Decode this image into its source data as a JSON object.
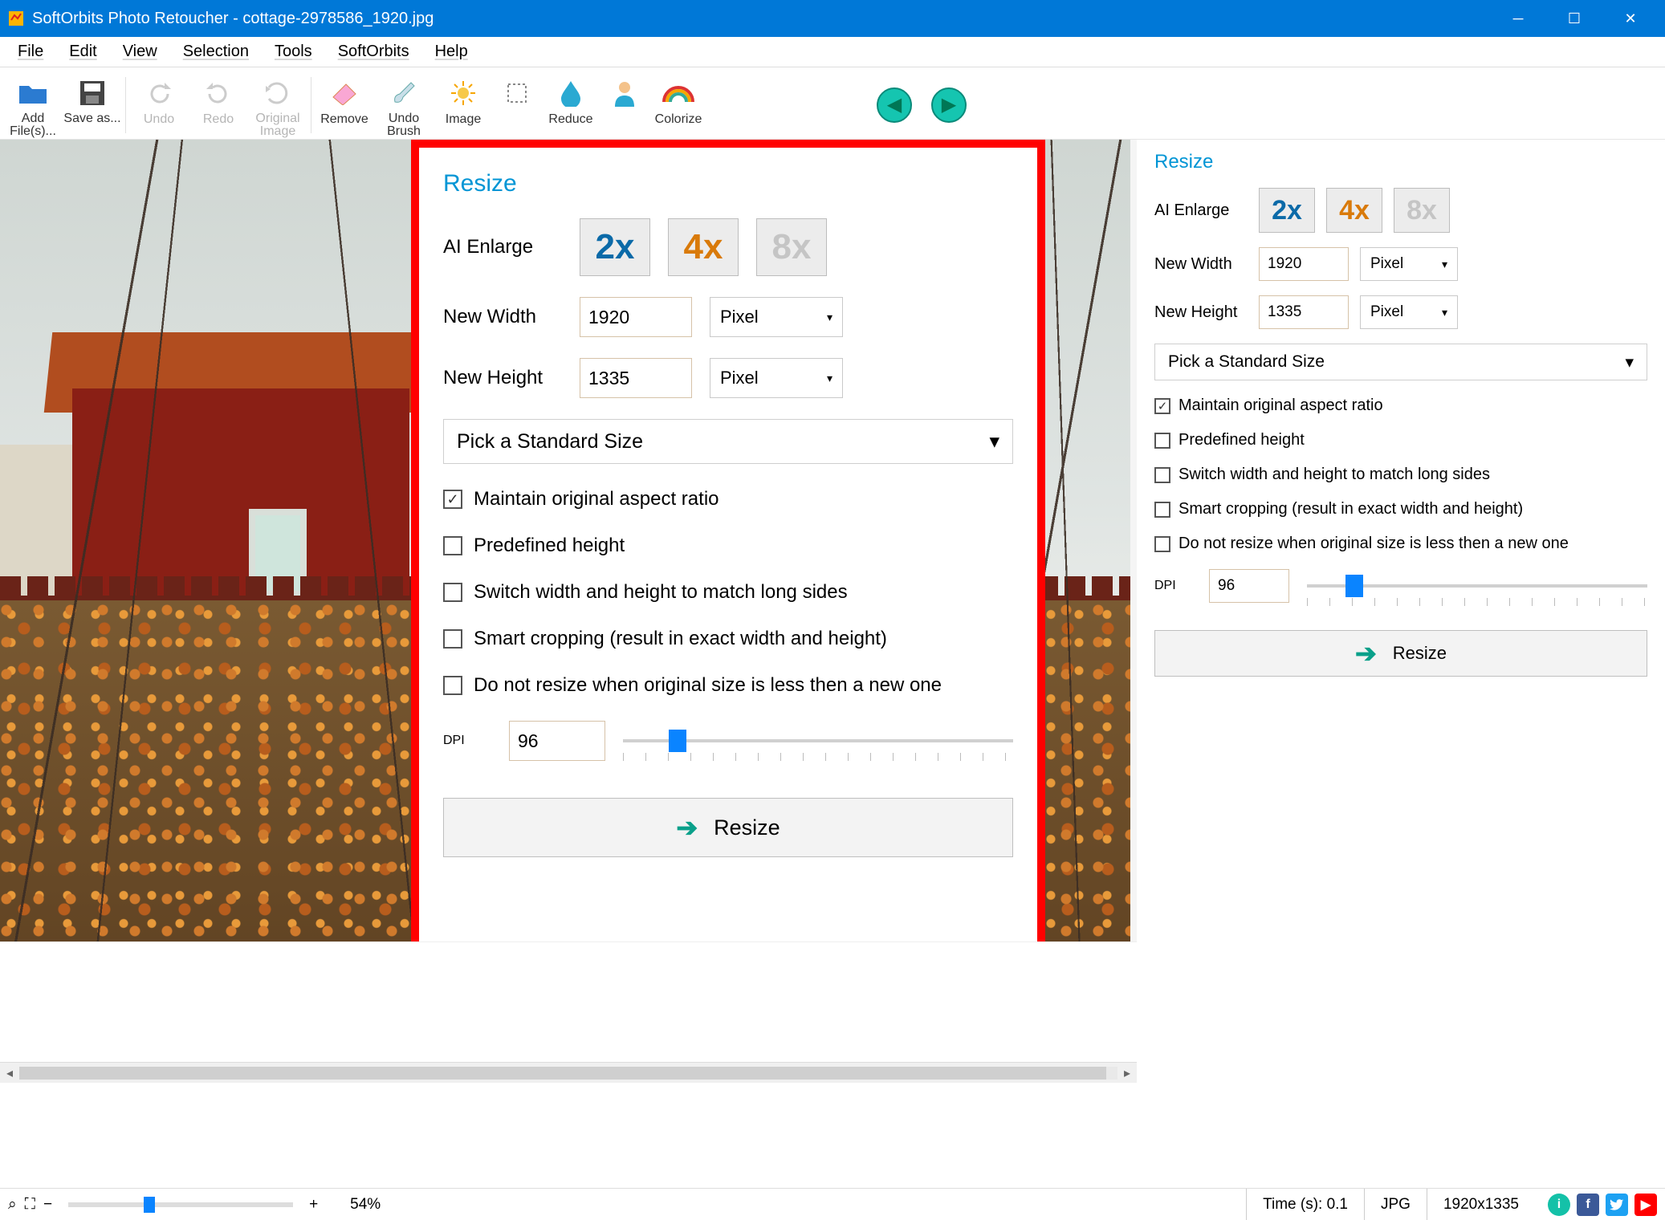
{
  "window": {
    "title": "SoftOrbits Photo Retoucher - cottage-2978586_1920.jpg"
  },
  "menu": {
    "items": [
      "File",
      "Edit",
      "View",
      "Selection",
      "Tools",
      "SoftOrbits",
      "Help"
    ]
  },
  "toolbar": {
    "add_files": "Add File(s)...",
    "save_as": "Save as...",
    "undo": "Undo",
    "redo": "Redo",
    "original_image": "Original Image",
    "remove": "Remove",
    "undo_brush": "Undo Brush",
    "image": "Image",
    "reduce": "Reduce",
    "colorize": "Colorize"
  },
  "resize_panel": {
    "title": "Resize",
    "ai_enlarge_label": "AI Enlarge",
    "enlarge_options": [
      "2x",
      "4x",
      "8x"
    ],
    "new_width_label": "New Width",
    "new_width_value": "1920",
    "new_height_label": "New Height",
    "new_height_value": "1335",
    "unit": "Pixel",
    "standard_size": "Pick a Standard Size",
    "maintain_aspect": "Maintain original aspect ratio",
    "predefined_height": "Predefined height",
    "switch_sides": "Switch width and height to match long sides",
    "smart_crop": "Smart cropping (result in exact width and height)",
    "no_resize_smaller": "Do not resize when original size is less then a new one",
    "dpi_label": "DPI",
    "dpi_value": "96",
    "resize_button": "Resize"
  },
  "statusbar": {
    "zoom_percent": "54%",
    "time": "Time (s): 0.1",
    "format": "JPG",
    "dimensions": "1920x1335"
  }
}
